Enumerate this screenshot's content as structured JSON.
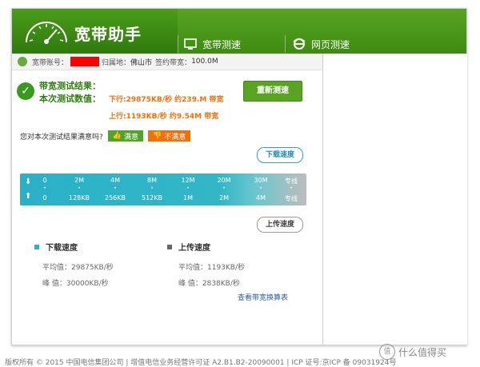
{
  "app": {
    "title": "宽带助手"
  },
  "nav": {
    "tabs": [
      {
        "label": "宽带测速",
        "icon": "monitor-icon"
      },
      {
        "label": "网页测速",
        "icon": "browser-ie-icon"
      }
    ]
  },
  "info": {
    "account_label": "宽带账号：",
    "region_label": "归属地：",
    "region_value": "佛山市",
    "contract_label": "签约带宽：",
    "contract_value": "100.0M"
  },
  "result": {
    "title": "带宽测试结果：",
    "subtitle": "本次测试数值：",
    "down_text": "下行:29875KB/秒 约239.M 带宽",
    "up_text": "上行:1193KB/秒 约9.54M 带宽",
    "retest_label": "重新测速"
  },
  "satisfaction": {
    "question": "您对本次测试结果满意吗?",
    "satisfied_label": "满意",
    "unsatisfied_label": "不满意"
  },
  "speedbar": {
    "download_bubble": "下载速度",
    "upload_bubble": "上传速度",
    "top_labels": [
      "0",
      "2M",
      "4M",
      "8M",
      "12M",
      "20M",
      "30M",
      "专线"
    ],
    "bottom_labels": [
      "0",
      "128KB",
      "256KB",
      "512KB",
      "1M",
      "2M",
      "4M",
      "专线"
    ]
  },
  "stats": {
    "download": {
      "title": "下载速度",
      "avg": "平均值：29875KB/秒",
      "peak": "峰 值：30000KB/秒",
      "color": "#2ab1c9"
    },
    "upload": {
      "title": "上传速度",
      "avg": "平均值：1193KB/秒",
      "peak": "峰 值：2838KB/秒",
      "color": "#666666"
    },
    "link_label": "查看带宽换算表"
  },
  "footer": {
    "text": "版权所有 © 2015 中国电信集团公司 | 增值电信业务经营许可证 A2.B1.B2-20090001 | ICP 证号:京ICP 备 09031924号",
    "watermark": "什么值得买",
    "watermark_badge": "值"
  },
  "colors": {
    "brand_green": "#3d8b12",
    "accent_orange": "#f26f0a",
    "cyan": "#2ab1c9"
  }
}
